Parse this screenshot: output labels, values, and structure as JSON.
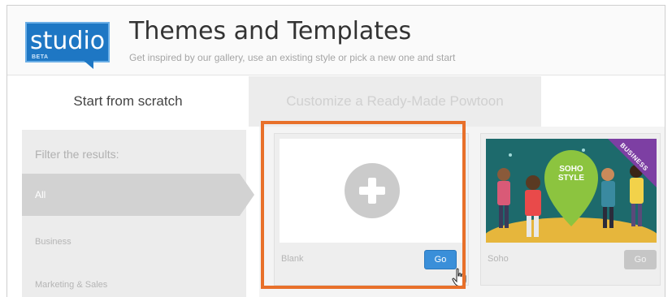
{
  "app": {
    "logo_text": "studio",
    "logo_badge": "BETA",
    "brand_color": "#1e77c4"
  },
  "header": {
    "title": "Themes and Templates",
    "subtitle": "Get inspired by our gallery, use an existing style or pick a new one and start"
  },
  "tabs": [
    {
      "label": "Start from scratch",
      "active": true
    },
    {
      "label": "Customize a Ready-Made Powtoon",
      "active": false
    }
  ],
  "sidebar": {
    "filter_label": "Filter the results:",
    "items": [
      {
        "label": "All",
        "selected": true
      },
      {
        "label": "Business",
        "selected": false
      },
      {
        "label": "Marketing & Sales",
        "selected": false
      }
    ]
  },
  "templates": [
    {
      "name": "Blank",
      "button": "Go",
      "button_color": "#3a8fd9",
      "highlighted": true,
      "icon": "plus-icon"
    },
    {
      "name": "Soho",
      "button": "Go",
      "button_color": "#c6c6c6",
      "highlighted": false,
      "preview_title": "SOHO STYLE",
      "ribbon": "BUSINESS"
    }
  ],
  "highlight_color": "#e8702a"
}
